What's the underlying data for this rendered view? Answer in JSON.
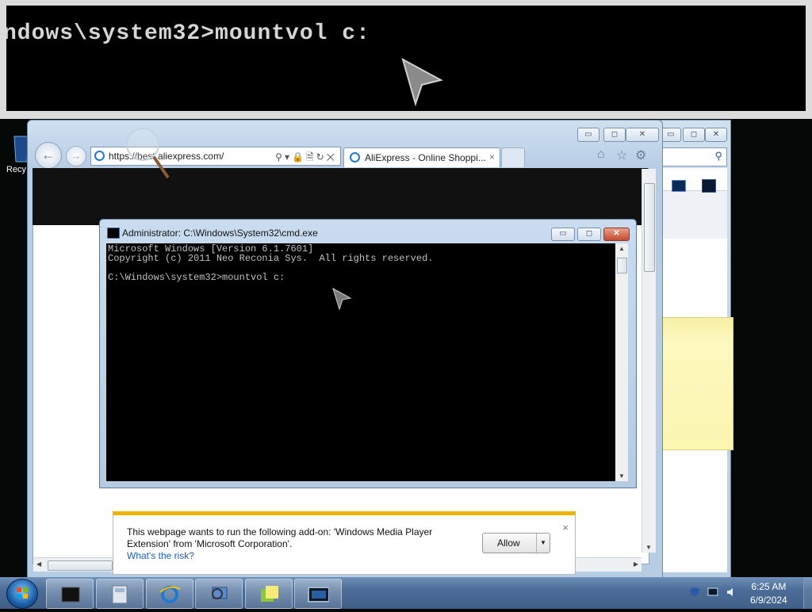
{
  "magnifier": {
    "text": "ndows\\system32>mountvol c:"
  },
  "desktop": {
    "recycle_label": "Recy"
  },
  "browser": {
    "url": "https://best.aliexpress.com/",
    "tab_title": "AliExpress - Online Shoppi...",
    "tab_close": "×",
    "window_buttons": {
      "minimize": "▭",
      "maximize": "◻",
      "close": "✕"
    },
    "toolbar_icons": [
      "home-icon",
      "favorites-star-icon",
      "settings-gear-icon"
    ]
  },
  "cmd": {
    "title": "Administrator: C:\\Windows\\System32\\cmd.exe",
    "lines": [
      "Microsoft Windows [Version 6.1.7601]",
      "Copyright (c) 2011 Neo Reconia Sys.  All rights reserved.",
      "",
      "C:\\Windows\\system32>mountvol c:"
    ]
  },
  "notification": {
    "message": "This webpage wants to run the following add-on: 'Windows Media Player Extension' from 'Microsoft Corporation'.",
    "link": "What's the risk?",
    "allow_label": "Allow",
    "close": "×"
  },
  "taskbar": {
    "time": "6:25 AM",
    "date": "6/9/2024",
    "items": [
      "media-player-icon",
      "calculator-icon",
      "internet-explorer-icon",
      "search-computer-icon",
      "sticky-notes-icon",
      "remote-desktop-icon"
    ]
  },
  "colors": {
    "accent": "#f0b400",
    "link": "#1b5fb5",
    "taskbar": "#4c6d97"
  }
}
